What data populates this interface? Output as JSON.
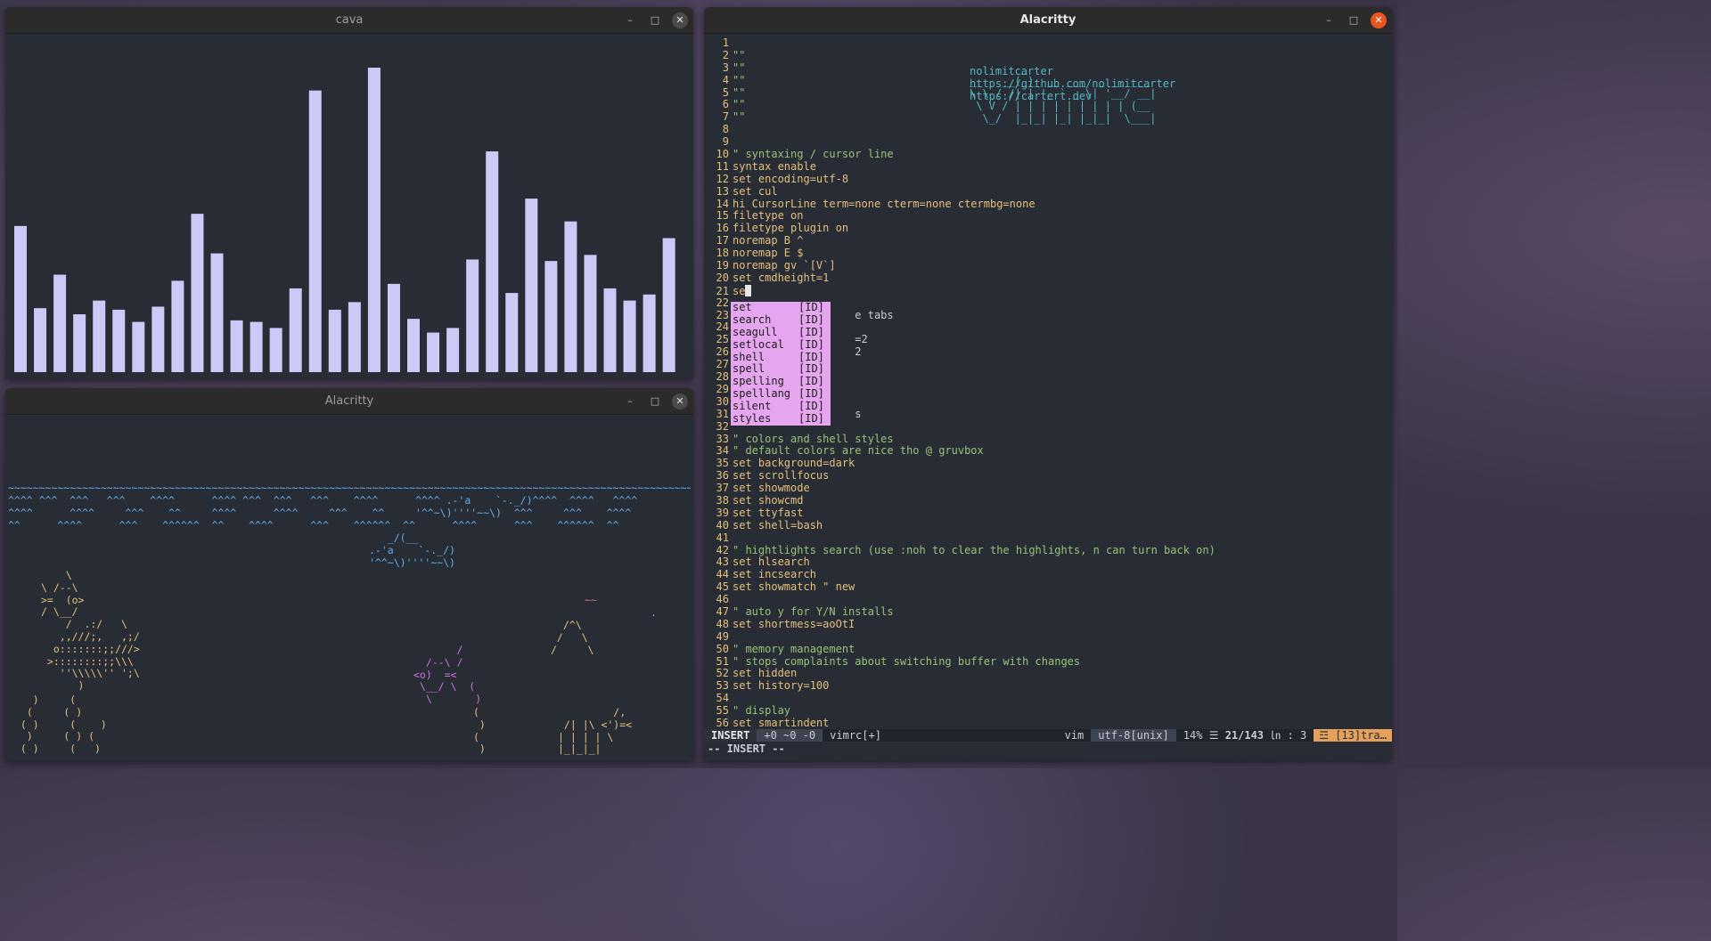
{
  "windows": {
    "cava": {
      "title": "cava",
      "bar_color": "#c9caf5",
      "bar_levels": [
        0.48,
        0.21,
        0.32,
        0.19,
        0.235,
        0.205,
        0.165,
        0.215,
        0.3,
        0.52,
        0.39,
        0.17,
        0.165,
        0.145,
        0.275,
        0.925,
        0.205,
        0.23,
        1.0,
        0.29,
        0.175,
        0.13,
        0.145,
        0.37,
        0.725,
        0.26,
        0.57,
        0.365,
        0.495,
        0.385,
        0.275,
        0.235,
        0.255,
        0.44
      ]
    },
    "aquarium": {
      "title": "Alacritty",
      "art": {
        "water_1": "~~~~~~~~~~~~~~~~~~~~~~~~~~~~~~~~~~~~~~~~~~~~~~~~~~~~~~~~~~~~~~~~~~~~~~~~~~~~~~~~~~~~~~~~~~~~~~~~~~~~~~~~~~~~~~~~",
        "water_2": "^^^^ ^^^  ^^^   ^^^    ^^^^      ^^^^ ^^^  ^^^   ^^^    ^^^^      ^^^^ .-'a    `-._/)^^^^  ^^^^   ^^^^",
        "water_3": "^^^^      ^^^^     ^^^    ^^     ^^^^      ^^^^     ^^^    ^^     '^^~\\)''''~~\\)  ^^^     ^^^    ^^^^",
        "water_4": "^^      ^^^^      ^^^    ^^^^^^  ^^    ^^^^      ^^^    ^^^^^^  ^^      ^^^^      ^^^    ^^^^^^  ^^",
        "shark_top": "                                                                                                ,\n                                                                                              _/(__\n                                                                                 ,         .-'a    `-._/)",
        "shark_tail": "                                                                              _/(___~~~~~~'^^~\\)'''''~~\\)~~~~",
        "shark_mid": "   _/(__\n.-'a    `-._/)\n'^^~\\)''''~~\\)",
        "fish_left": "    \\\n\\ /--\\\n>=  (o>\n/ \\__/\n    /  .:/   \\\n   ,,///;,   ,;/\n  o:::::::;;///>\n >::::::::;;\\\\\\\n   ''\\\\\\\\\\'' ';\\\n      )",
        "weed_left": "   )     (\n  (     ( )\n ( )     (    )\n  )     ( ) (\n ( )     (   )",
        "fish_mid": "       /\n  /--\\ /\n<o)  =<\n \\__/ \\  (\n  \\       )",
        "weed_mid": "(\n )\n(\n )",
        "castle": "  /^\\\n /   \\\n/     \\",
        "ship_tag": "~~",
        "dot": ".",
        "crab": "         /,\n /| |\\ <')=<\n| | | | \\\n|_|_|_|"
      }
    },
    "vim": {
      "title": "Alacritty",
      "logo": "        _\n__   __(_)_ __ ___  _ __ ___\n\\ \\ / /| | '_ ` _ \\| '__/ __|\n \\ V / | | | | | | | | | (__\n  \\_/  |_|_| |_| |_|_|  \\___|",
      "links": [
        "nolimitcarter",
        "https://github.com/nolimitcarter",
        "https://cartert.dev"
      ],
      "lines": [
        {
          "n": "1",
          "t": ""
        },
        {
          "n": "2",
          "t": "\"\""
        },
        {
          "n": "3",
          "t": "\"\""
        },
        {
          "n": "4",
          "t": "\"\""
        },
        {
          "n": "5",
          "t": "\"\""
        },
        {
          "n": "6",
          "t": "\"\""
        },
        {
          "n": "7",
          "t": "\"\""
        },
        {
          "n": "8",
          "t": ""
        },
        {
          "n": "9",
          "t": ""
        },
        {
          "n": "10",
          "t": "\" syntaxing / cursor line"
        },
        {
          "n": "11",
          "t": "syntax enable"
        },
        {
          "n": "12",
          "t": "set encoding=utf-8"
        },
        {
          "n": "13",
          "t": "set cul"
        },
        {
          "n": "14",
          "t": "hi CursorLine term=none cterm=none ctermbg=none"
        },
        {
          "n": "15",
          "t": "filetype on"
        },
        {
          "n": "16",
          "t": "filetype plugin on"
        },
        {
          "n": "17",
          "t": "noremap B ^"
        },
        {
          "n": "18",
          "t": "noremap E $"
        },
        {
          "n": "19",
          "t": "noremap gv `[V`]"
        },
        {
          "n": "20",
          "t": "set cmdheight=1"
        },
        {
          "n": "21",
          "t": "se"
        },
        {
          "n": "22",
          "t": ""
        },
        {
          "n": "23",
          "t": "                   e tabs"
        },
        {
          "n": "24",
          "t": ""
        },
        {
          "n": "25",
          "t": "                   =2"
        },
        {
          "n": "26",
          "t": "                   2"
        },
        {
          "n": "27",
          "t": ""
        },
        {
          "n": "28",
          "t": ""
        },
        {
          "n": "29",
          "t": ""
        },
        {
          "n": "30",
          "t": ""
        },
        {
          "n": "31",
          "t": "                   s"
        },
        {
          "n": "32",
          "t": ""
        },
        {
          "n": "33",
          "t": "\" colors and shell styles"
        },
        {
          "n": "34",
          "t": "\" default colors are nice tho @ gruvbox"
        },
        {
          "n": "35",
          "t": "set background=dark"
        },
        {
          "n": "36",
          "t": "set scrollfocus"
        },
        {
          "n": "37",
          "t": "set showmode"
        },
        {
          "n": "38",
          "t": "set showcmd"
        },
        {
          "n": "39",
          "t": "set ttyfast"
        },
        {
          "n": "40",
          "t": "set shell=bash"
        },
        {
          "n": "41",
          "t": ""
        },
        {
          "n": "42",
          "t": "\" hightlights search (use :noh to clear the highlights, n can turn back on)"
        },
        {
          "n": "43",
          "t": "set hlsearch"
        },
        {
          "n": "44",
          "t": "set incsearch"
        },
        {
          "n": "45",
          "t": "set showmatch \" new"
        },
        {
          "n": "46",
          "t": ""
        },
        {
          "n": "47",
          "t": "\" auto y for Y/N installs"
        },
        {
          "n": "48",
          "t": "set shortmess=aoOtI"
        },
        {
          "n": "49",
          "t": ""
        },
        {
          "n": "50",
          "t": "\" memory management"
        },
        {
          "n": "51",
          "t": "\" stops complaints about switching buffer with changes"
        },
        {
          "n": "52",
          "t": "set hidden"
        },
        {
          "n": "53",
          "t": "set history=100"
        },
        {
          "n": "54",
          "t": ""
        },
        {
          "n": "55",
          "t": "\" display"
        },
        {
          "n": "56",
          "t": "set smartindent"
        }
      ],
      "completion": [
        {
          "word": "set",
          "kind": "[ID]"
        },
        {
          "word": "search",
          "kind": "[ID]"
        },
        {
          "word": "seagull",
          "kind": "[ID]"
        },
        {
          "word": "setlocal",
          "kind": "[ID]"
        },
        {
          "word": "shell",
          "kind": "[ID]"
        },
        {
          "word": "spell",
          "kind": "[ID]"
        },
        {
          "word": "spelling",
          "kind": "[ID]"
        },
        {
          "word": "spelllang",
          "kind": "[ID]"
        },
        {
          "word": "silent",
          "kind": "[ID]"
        },
        {
          "word": "styles",
          "kind": "[ID]"
        }
      ],
      "status": {
        "mode": "INSERT",
        "hunks": "+0 ~0 -0",
        "file": "vimrc[+]",
        "filetype": "vim",
        "encoding": "utf-8[unix]",
        "percent": "14%",
        "percent_icon": "☰",
        "position": "21/143",
        "col_icon": "㏑",
        "col": ":  3",
        "warning": "☲ [13]tra…"
      },
      "cmdline": "-- INSERT --"
    }
  }
}
